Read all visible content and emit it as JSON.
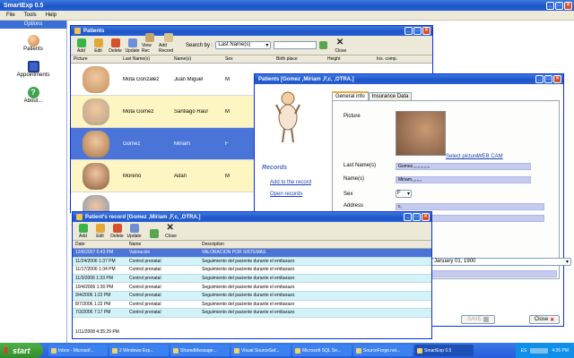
{
  "app": {
    "title": "SmartExp 0.5",
    "menu": [
      "File",
      "Tools",
      "Help"
    ]
  },
  "sidebar": {
    "section": "Options",
    "items": [
      {
        "label": "Patients"
      },
      {
        "label": "Appointments"
      },
      {
        "label": "About..."
      }
    ]
  },
  "patients": {
    "title": "Patients",
    "toolbar": [
      "Add",
      "Edit",
      "Delete",
      "Update",
      "View Rec",
      "Add Record"
    ],
    "search_label": "Search by :",
    "search_field": "Last Name(s)",
    "search_value": "",
    "close_label": "Close",
    "columns": [
      "Picture",
      "Last Name(s)",
      "Name(s)",
      "Sex",
      "Birth place",
      "Height",
      "Ins. comp."
    ],
    "rows": [
      {
        "last": "Mota Gonzalez",
        "name": "Juan Miguel",
        "sex": "M",
        "pic": "#c6925e"
      },
      {
        "last": "Mota Gomez",
        "name": "Santiago Raul",
        "sex": "M",
        "pic": "#b9a188"
      },
      {
        "last": "Gomez",
        "name": "Miriam",
        "sex": "F",
        "pic": "#a97448"
      },
      {
        "last": "Moreno",
        "name": "Adan",
        "sex": "M",
        "pic": "#8b5a3c"
      },
      {
        "last": "",
        "name": "",
        "sex": "",
        "pic": "#7b8fb0"
      }
    ]
  },
  "detail": {
    "title": "Patients [Gomez ,Miriam ,F,c, ,OTRA.]",
    "tabs": [
      "General info",
      "Insurance Data"
    ],
    "records_heading": "Records",
    "add_record_link": "Add to the record",
    "open_records_link": "Open records",
    "picture_label": "Picture",
    "select_picture": "Select picture",
    "webcam": "WEB CAM",
    "last_label": "Last Name(s)",
    "last_value": "Gomez,,,,,,,,,,,,,,",
    "name_label": "Name(s)",
    "name_value": "Miriam,,,,,,,,",
    "sex_label": "Sex",
    "sex_value": "F",
    "address_label": "Address",
    "address_value": "c,",
    "date_value": "January 01, 1900",
    "save_label": "SAVE",
    "close_label": "Close"
  },
  "record": {
    "title": "Patient's record [Gomez ,Miriam ,F,c, ,OTRA.]",
    "toolbar": [
      "Add",
      "Edit",
      "Delete",
      "Update",
      "Close"
    ],
    "columns": [
      "Date",
      "Name",
      "Description"
    ],
    "rows": [
      {
        "date": "12/8/2007 6:43 PM",
        "name": "Valoración",
        "desc": "VALORACION POR SISTEMAS"
      },
      {
        "date": "11/24/2006 1:37 PM",
        "name": "Control prenatal",
        "desc": "Seguimiento del paciente durante el embarazo"
      },
      {
        "date": "11/17/2006 1:34 PM",
        "name": "Control prenatal",
        "desc": "Seguimiento del paciente durante el embarazo"
      },
      {
        "date": "11/3/2006 1:33 PM",
        "name": "Control prenatal",
        "desc": "Seguimiento del paciente durante el embarazo"
      },
      {
        "date": "10/4/2006 1:30 PM",
        "name": "Control prenatal",
        "desc": "Seguimiento del paciente durante el embarazo"
      },
      {
        "date": "9/4/2006 1:22 PM",
        "name": "Control prenatal",
        "desc": "Seguimiento del paciente durante el embarazo"
      },
      {
        "date": "8/7/2006 1:22 PM",
        "name": "Control prenatal",
        "desc": "Seguimiento del paciente durante el embarazo"
      },
      {
        "date": "7/3/2006 7:17 PM",
        "name": "Control prenatal",
        "desc": "Seguimiento del paciente durante el embarazo"
      }
    ],
    "status": "1/11/2008   4:35:29 PM"
  },
  "taskbar": {
    "start": "start",
    "items": [
      "Inbox - Microsof...",
      "2 Windows Exp...",
      "SharedMessage...",
      "Visual SourceSaf...",
      "Microsoft SQL Se...",
      "SourceForge.net...",
      "SmartExp 0.5"
    ],
    "lang": "ES",
    "clock": "4:35 PM"
  },
  "colors": {
    "titlebar": "#1d55c9",
    "selected_row": "#4a74d8",
    "row_alt": "#fdf6c3",
    "record_row": "#d3f3f8"
  }
}
